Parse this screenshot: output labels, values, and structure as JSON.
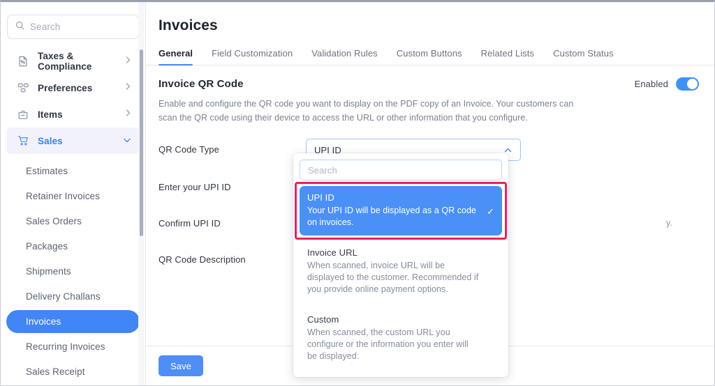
{
  "sidebar": {
    "search": {
      "placeholder": "Search",
      "icon": "search-icon"
    },
    "groups": [
      {
        "label": "Taxes & Compliance",
        "icon": "tax-document-icon",
        "chevron": "chevron-right-icon",
        "active": false
      },
      {
        "label": "Preferences",
        "icon": "preferences-grid-icon",
        "chevron": "chevron-right-icon",
        "active": false
      },
      {
        "label": "Items",
        "icon": "items-bag-icon",
        "chevron": "chevron-right-icon",
        "active": false
      },
      {
        "label": "Sales",
        "icon": "sales-cart-icon",
        "chevron": "chevron-down-icon",
        "active": true
      }
    ],
    "sub_items": [
      {
        "label": "Estimates",
        "selected": false
      },
      {
        "label": "Retainer Invoices",
        "selected": false
      },
      {
        "label": "Sales Orders",
        "selected": false
      },
      {
        "label": "Packages",
        "selected": false
      },
      {
        "label": "Shipments",
        "selected": false
      },
      {
        "label": "Delivery Challans",
        "selected": false
      },
      {
        "label": "Invoices",
        "selected": true
      },
      {
        "label": "Recurring Invoices",
        "selected": false
      },
      {
        "label": "Sales Receipt",
        "selected": false
      }
    ]
  },
  "main": {
    "page_title": "Invoices",
    "tabs": [
      {
        "label": "General",
        "active": true
      },
      {
        "label": "Field Customization",
        "active": false
      },
      {
        "label": "Validation Rules",
        "active": false
      },
      {
        "label": "Custom Buttons",
        "active": false
      },
      {
        "label": "Related Lists",
        "active": false
      },
      {
        "label": "Custom Status",
        "active": false
      }
    ],
    "section": {
      "title": "Invoice QR Code",
      "toggle_label": "Enabled",
      "toggle_on": true,
      "description": "Enable and configure the QR code you want to display on the PDF copy of an Invoice. Your customers can scan the QR code using their device to access the URL or other information that you configure."
    },
    "form": {
      "qr_code_type_label": "QR Code Type",
      "qr_code_type_value": "UPI ID",
      "enter_upi_id_label": "Enter your UPI ID",
      "confirm_upi_id_label": "Confirm UPI ID",
      "qr_code_description_label": "QR Code Description",
      "obscured_hint_fragment": "y."
    },
    "dropdown": {
      "search_placeholder": "Search",
      "options": [
        {
          "title": "UPI ID",
          "description": "Your UPI ID will be displayed as a QR code on invoices.",
          "selected": true,
          "check": "✓"
        },
        {
          "title": "Invoice URL",
          "description": "When scanned, invoice URL will be displayed to the customer. Recommended if you provide online payment options.",
          "selected": false,
          "check": ""
        },
        {
          "title": "Custom",
          "description": "When scanned, the custom URL you configure or the information you enter will be displayed.",
          "selected": false,
          "check": ""
        }
      ]
    },
    "footer": {
      "save_label": "Save"
    }
  },
  "colors": {
    "accent_blue": "#4285f4",
    "select_border": "#9dc4fb",
    "highlight_pink": "#ef1e5e",
    "toggle_on": "#3b93f7"
  }
}
